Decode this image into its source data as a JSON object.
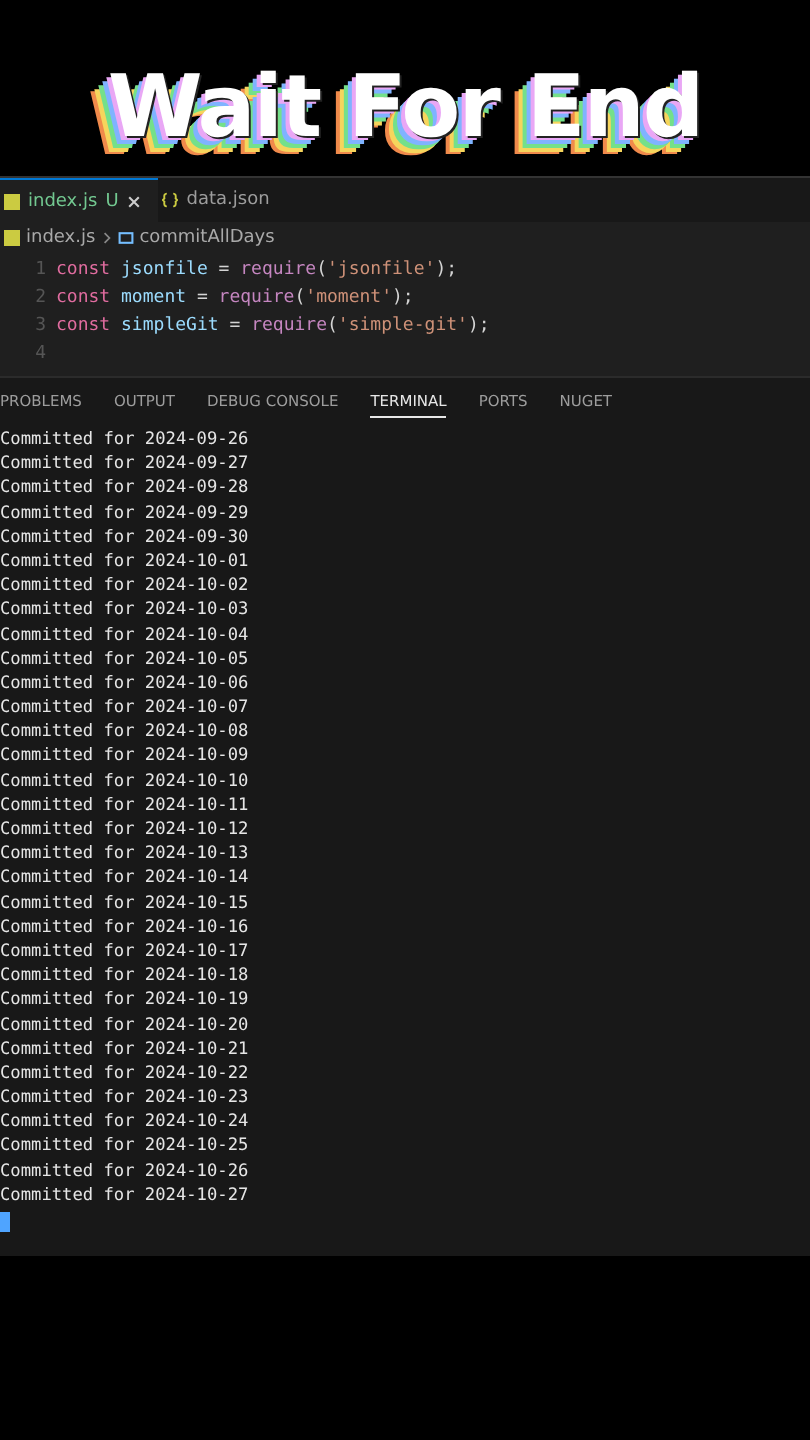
{
  "overlay_title": "Wait For End",
  "editor_tabs": [
    {
      "label": "index.js",
      "kind": "js",
      "status": "U",
      "selected": true
    },
    {
      "label": "data.json",
      "kind": "json",
      "selected": false
    }
  ],
  "breadcrumb": [
    "index.js",
    "commitAllDays"
  ],
  "code_lines": [
    {
      "number": "1",
      "tokens": [
        {
          "kind": "keyword",
          "text": "const "
        },
        {
          "kind": "variable",
          "text": "jsonfile"
        },
        {
          "kind": "plain",
          "text": " = "
        },
        {
          "kind": "function",
          "text": "require"
        },
        {
          "kind": "plain",
          "text": "("
        },
        {
          "kind": "string",
          "text": "'jsonfile'"
        },
        {
          "kind": "plain",
          "text": ");"
        }
      ]
    },
    {
      "number": "2",
      "tokens": [
        {
          "kind": "keyword",
          "text": "const "
        },
        {
          "kind": "variable",
          "text": "moment"
        },
        {
          "kind": "plain",
          "text": " = "
        },
        {
          "kind": "function",
          "text": "require"
        },
        {
          "kind": "plain",
          "text": "("
        },
        {
          "kind": "string",
          "text": "'moment'"
        },
        {
          "kind": "plain",
          "text": ");"
        }
      ]
    },
    {
      "number": "3",
      "tokens": [
        {
          "kind": "keyword",
          "text": "const "
        },
        {
          "kind": "variable",
          "text": "simpleGit"
        },
        {
          "kind": "plain",
          "text": " = "
        },
        {
          "kind": "function",
          "text": "require"
        },
        {
          "kind": "plain",
          "text": "("
        },
        {
          "kind": "string",
          "text": "'simple-git'"
        },
        {
          "kind": "plain",
          "text": ");"
        }
      ]
    },
    {
      "number": "4"
    }
  ],
  "panel_tabs": [
    {
      "label": "PROBLEMS",
      "selected": false
    },
    {
      "label": "OUTPUT",
      "selected": false
    },
    {
      "label": "DEBUG CONSOLE",
      "selected": false
    },
    {
      "label": "TERMINAL",
      "selected": true
    },
    {
      "label": "PORTS",
      "selected": false
    },
    {
      "label": "NUGET",
      "selected": false
    }
  ],
  "terminal_lines": [
    "Committed for 2024-09-26",
    "Committed for 2024-09-27",
    "Committed for 2024-09-28",
    "Committed for 2024-09-29",
    "Committed for 2024-09-30",
    "Committed for 2024-10-01",
    "Committed for 2024-10-02",
    "Committed for 2024-10-03",
    "Committed for 2024-10-04",
    "Committed for 2024-10-05",
    "Committed for 2024-10-06",
    "Committed for 2024-10-07",
    "Committed for 2024-10-08",
    "Committed for 2024-10-09",
    "Committed for 2024-10-10",
    "Committed for 2024-10-11",
    "Committed for 2024-10-12",
    "Committed for 2024-10-13",
    "Committed for 2024-10-14",
    "Committed for 2024-10-15",
    "Committed for 2024-10-16",
    "Committed for 2024-10-17",
    "Committed for 2024-10-18",
    "Committed for 2024-10-19",
    "Committed for 2024-10-20",
    "Committed for 2024-10-21",
    "Committed for 2024-10-22",
    "Committed for 2024-10-23",
    "Committed for 2024-10-24",
    "Committed for 2024-10-25",
    "Committed for 2024-10-26",
    "Committed for 2024-10-27"
  ]
}
